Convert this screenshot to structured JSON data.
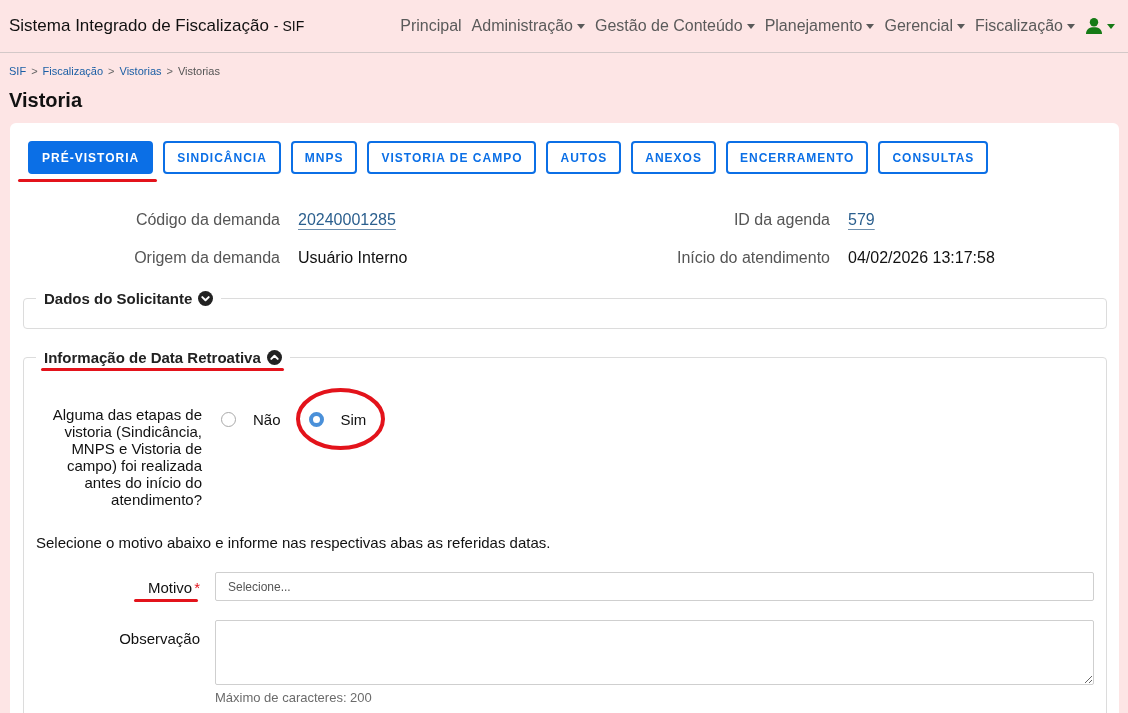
{
  "header": {
    "title": "Sistema Integrado de Fiscalização",
    "suffix": "- SIF",
    "nav": [
      {
        "label": "Principal",
        "dropdown": false
      },
      {
        "label": "Administração",
        "dropdown": true
      },
      {
        "label": "Gestão de Conteúdo",
        "dropdown": true
      },
      {
        "label": "Planejamento",
        "dropdown": true
      },
      {
        "label": "Gerencial",
        "dropdown": true
      },
      {
        "label": "Fiscalização",
        "dropdown": true
      }
    ],
    "user_menu": {
      "dropdown": true
    }
  },
  "breadcrumb": {
    "separator": ">",
    "items": [
      {
        "label": "SIF",
        "link": true
      },
      {
        "label": "Fiscalização",
        "link": true
      },
      {
        "label": "Vistorias",
        "link": true
      },
      {
        "label": "Vistorias",
        "link": false
      }
    ]
  },
  "page_title": "Vistoria",
  "tabs": [
    {
      "label": "PRÉ-VISTORIA",
      "selected": true,
      "highlighted": true
    },
    {
      "label": "SINDICÂNCIA",
      "selected": false,
      "highlighted": false
    },
    {
      "label": "MNPS",
      "selected": false,
      "highlighted": false
    },
    {
      "label": "VISTORIA DE CAMPO",
      "selected": false,
      "highlighted": false
    },
    {
      "label": "AUTOS",
      "selected": false,
      "highlighted": false
    },
    {
      "label": "ANEXOS",
      "selected": false,
      "highlighted": false
    },
    {
      "label": "ENCERRAMENTO",
      "selected": false,
      "highlighted": false
    },
    {
      "label": "CONSULTAS",
      "selected": false,
      "highlighted": false
    }
  ],
  "summary": [
    {
      "label": "Código da demanda",
      "value": "20240001285",
      "link": true
    },
    {
      "label": "ID da agenda",
      "value": "579",
      "link": true
    },
    {
      "label": "Origem da demanda",
      "value": "Usuário Interno",
      "link": false
    },
    {
      "label": "Início do atendimento",
      "value": "04/02/2026 13:17:58",
      "link": false
    }
  ],
  "sections": [
    {
      "title": "Dados do Solicitante",
      "expanded": false,
      "highlighted": false
    },
    {
      "title": "Informação de Data Retroativa",
      "expanded": true,
      "highlighted": true,
      "question": {
        "label": "Alguma das etapas de vistoria (Sindicância, MNPS e Vistoria de campo) foi realizada antes do início do atendimento?",
        "options": [
          {
            "label": "Não",
            "selected": false,
            "circled": false
          },
          {
            "label": "Sim",
            "selected": true,
            "circled": true
          }
        ]
      },
      "instruction": "Selecione o motivo abaixo e informe nas respectivas abas as referidas datas.",
      "fields": [
        {
          "kind": "select",
          "label": "Motivo",
          "required_mark": "*",
          "highlighted": true,
          "placeholder": "Selecione..."
        },
        {
          "kind": "textarea",
          "label": "Observação",
          "highlighted": false,
          "hint": "Máximo de caracteres: 200"
        }
      ]
    }
  ]
}
